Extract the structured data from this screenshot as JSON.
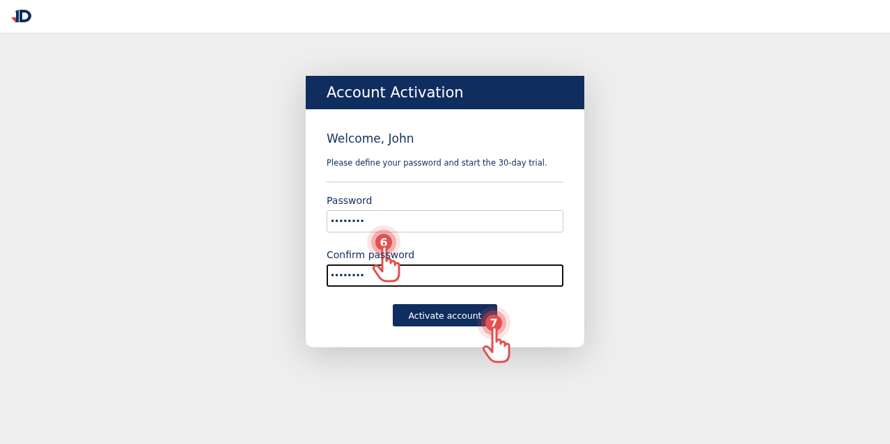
{
  "card": {
    "title": "Account Activation",
    "greeting": "Welcome, John",
    "subtitle": "Please define your password and start the 30-day trial.",
    "fields": [
      {
        "label": "Password",
        "value": "••••••••",
        "focused": false
      },
      {
        "label": "Confirm password",
        "value": "••••••••",
        "focused": true
      }
    ],
    "button": "Activate account"
  },
  "callouts": [
    {
      "number": "6"
    },
    {
      "number": "7"
    }
  ]
}
